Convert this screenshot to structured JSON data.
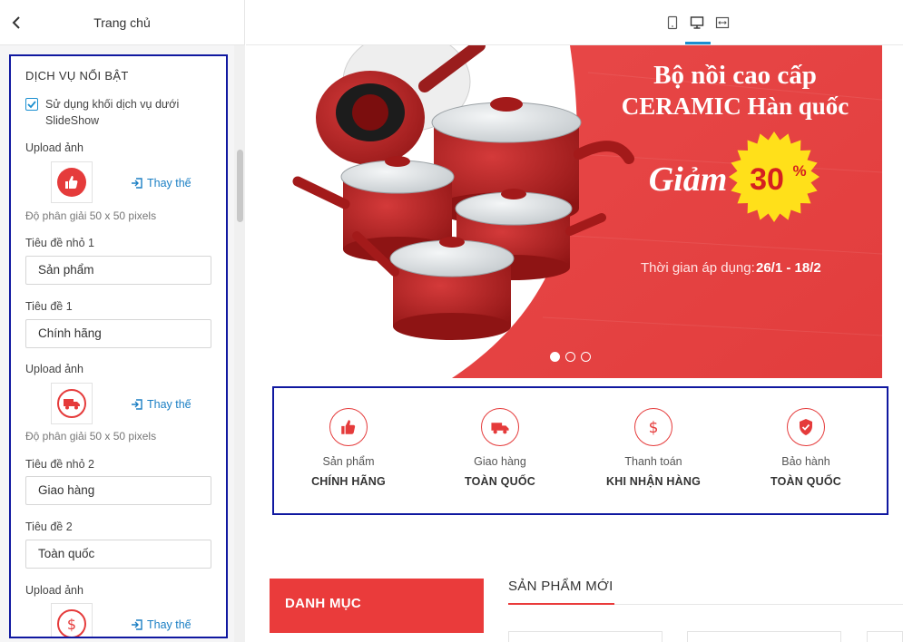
{
  "panel": {
    "header_title": "Trang chủ",
    "section_title": "DỊCH VỤ NỔI BẬT",
    "checkbox_label": "Sử dụng khối dịch vụ dưới SlideShow",
    "upload_label": "Upload ảnh",
    "replace_label": "Thay thế",
    "resolution_hint": "Độ phân giải 50 x 50 pixels",
    "fields": [
      {
        "label": "Tiêu đề nhỏ 1",
        "value": "Sản phẩm"
      },
      {
        "label": "Tiêu đề 1",
        "value": "Chính hãng"
      },
      {
        "label": "Tiêu đề nhỏ 2",
        "value": "Giao hàng"
      },
      {
        "label": "Tiêu đề 2",
        "value": "Toàn quốc"
      }
    ],
    "icons": [
      "thumbs-up-icon",
      "truck-icon",
      "dollar-icon"
    ]
  },
  "banner": {
    "headline_1": "Bộ nồi cao cấp",
    "headline_2": "CERAMIC Hàn quốc",
    "discount_word": "Giảm",
    "discount_value": "30",
    "discount_unit": "%",
    "period_label": "Thời gian áp dụng:",
    "period_value": "26/1 - 18/2",
    "active_slide": 1,
    "slide_count": 3
  },
  "features": [
    {
      "small": "Sản phẩm",
      "big": "CHÍNH HÃNG",
      "icon": "thumbs-up-icon"
    },
    {
      "small": "Giao hàng",
      "big": "TOÀN QUỐC",
      "icon": "truck-icon"
    },
    {
      "small": "Thanh toán",
      "big": "KHI NHẬN HÀNG",
      "icon": "dollar-icon"
    },
    {
      "small": "Bảo hành",
      "big": "TOÀN QUỐC",
      "icon": "shield-check-icon"
    }
  ],
  "bottom": {
    "category_title": "DANH MỤC",
    "new_products_title": "SẢN PHẨM MỚI"
  },
  "colors": {
    "accent_red": "#ea3b3b",
    "link_blue": "#1b7fc4",
    "highlight_border": "#1018a0",
    "badge_yellow": "#ffe01a"
  }
}
